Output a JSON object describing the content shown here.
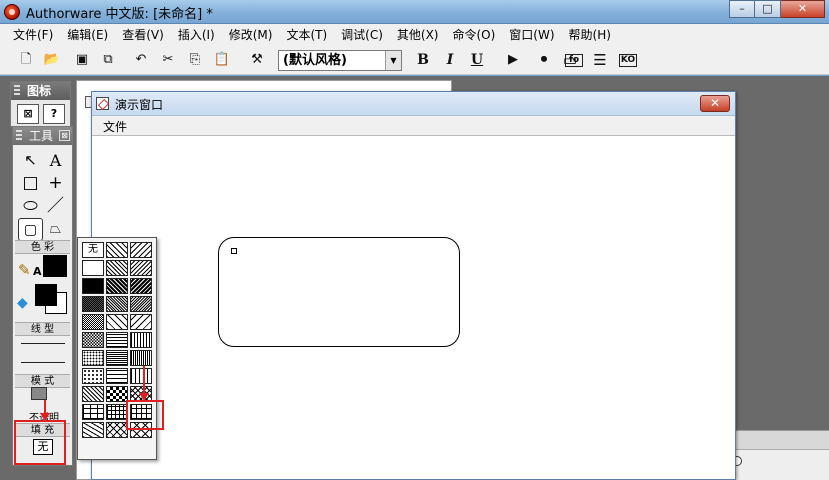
{
  "app": {
    "title": "Authorware 中文版: [未命名] *",
    "window_buttons": {
      "minimize": "–",
      "maximize": "□",
      "close": "✕"
    }
  },
  "menu": [
    "文件(F)",
    "编辑(E)",
    "查看(V)",
    "插入(I)",
    "修改(M)",
    "文本(T)",
    "调试(C)",
    "其他(X)",
    "命令(O)",
    "窗口(W)",
    "帮助(H)"
  ],
  "toolbar": {
    "style_select": "(默认风格)",
    "bold": "B",
    "italic": "I",
    "underline": "U",
    "functions_icon": "fo",
    "knowledge_icon": "KO"
  },
  "icon_palette": {
    "title": "图标"
  },
  "tools_panel": {
    "title": "工具",
    "close": "⊠",
    "color_label": "色 彩",
    "color_text_letter": "A",
    "line_label": "线 型",
    "mode_label": "模 式",
    "mode_value": "不透明",
    "fill_label": "填 充",
    "fill_value": "无"
  },
  "presentation": {
    "title": "演示窗口",
    "menu_file": "文件",
    "close": "✕"
  },
  "fill_dropdown": {
    "none_label": "无"
  },
  "colors": {
    "accent_red": "#e02020",
    "title_bar": "#83b0da",
    "workspace": "#6a6a6a"
  }
}
